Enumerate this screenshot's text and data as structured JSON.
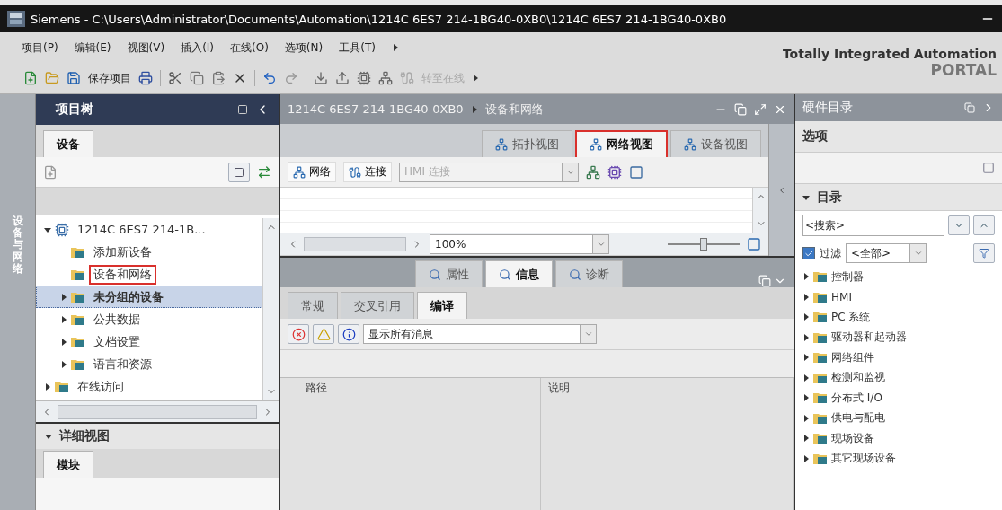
{
  "window": {
    "title": "Siemens - C:\\Users\\Administrator\\Documents\\Automation\\1214C 6ES7 214-1BG40-0XB0\\1214C 6ES7 214-1BG40-0XB0"
  },
  "menu": [
    "项目(P)",
    "编辑(E)",
    "视图(V)",
    "插入(I)",
    "在线(O)",
    "选项(N)",
    "工具(T)"
  ],
  "toolbar": {
    "save_label": "保存项目",
    "go_online": {
      "label": "转至在线",
      "disabled": true
    }
  },
  "brand": {
    "line1": "Totally Integrated Automation",
    "line2": "PORTAL"
  },
  "side_strip": {
    "label": "设备与网络"
  },
  "project_tree": {
    "title": "项目树",
    "tab": "设备",
    "items": [
      {
        "label": "1214C 6ES7 214-1B...",
        "expanded": true,
        "selected": false,
        "highlighted": false,
        "children": [
          {
            "label": "添加新设备",
            "selected": false,
            "highlighted": false
          },
          {
            "label": "设备和网络",
            "selected": false,
            "highlighted": true
          },
          {
            "label": "未分组的设备",
            "expanded": false,
            "selected": true,
            "highlighted": false
          },
          {
            "label": "公共数据",
            "expanded": false,
            "selected": false,
            "highlighted": false
          },
          {
            "label": "文档设置",
            "expanded": false,
            "selected": false,
            "highlighted": false
          },
          {
            "label": "语言和资源",
            "expanded": false,
            "selected": false,
            "highlighted": false
          }
        ]
      },
      {
        "label": "在线访问",
        "expanded": false,
        "selected": false,
        "highlighted": false
      }
    ]
  },
  "details": {
    "title": "详细视图",
    "expanded": true,
    "tab": "模块"
  },
  "editor": {
    "breadcrumb": [
      "1214C 6ES7 214-1BG40-0XB0",
      "设备和网络"
    ],
    "view_tabs": [
      {
        "label": "拓扑视图",
        "selected": false,
        "highlighted": false
      },
      {
        "label": "网络视图",
        "selected": true,
        "highlighted": true
      },
      {
        "label": "设备视图",
        "selected": false,
        "highlighted": false
      }
    ],
    "toolbar": {
      "network": "网络",
      "connections": "连接",
      "connection_type": {
        "value": "HMI 连接",
        "disabled": true
      }
    },
    "zoom": "100%",
    "zoom_slider": {
      "level": 0.5
    }
  },
  "inspector": {
    "tabs": [
      {
        "label": "属性",
        "selected": false
      },
      {
        "label": "信息",
        "selected": true
      },
      {
        "label": "诊断",
        "selected": false
      }
    ],
    "subtabs": [
      {
        "label": "常规",
        "selected": false
      },
      {
        "label": "交叉引用",
        "selected": false
      },
      {
        "label": "编译",
        "selected": true
      }
    ],
    "filter": "显示所有消息",
    "columns": [
      "路径",
      "说明"
    ]
  },
  "catalog": {
    "title": "硬件目录",
    "options": "选项",
    "section": "目录",
    "expanded": true,
    "search": {
      "placeholder": "<搜索>"
    },
    "filter": {
      "label": "过滤",
      "checked": true,
      "value": "<全部>"
    },
    "items": [
      "控制器",
      "HMI",
      "PC 系统",
      "驱动器和起动器",
      "网络组件",
      "检测和监视",
      "分布式 I/O",
      "供电与配电",
      "现场设备",
      "其它现场设备"
    ]
  }
}
